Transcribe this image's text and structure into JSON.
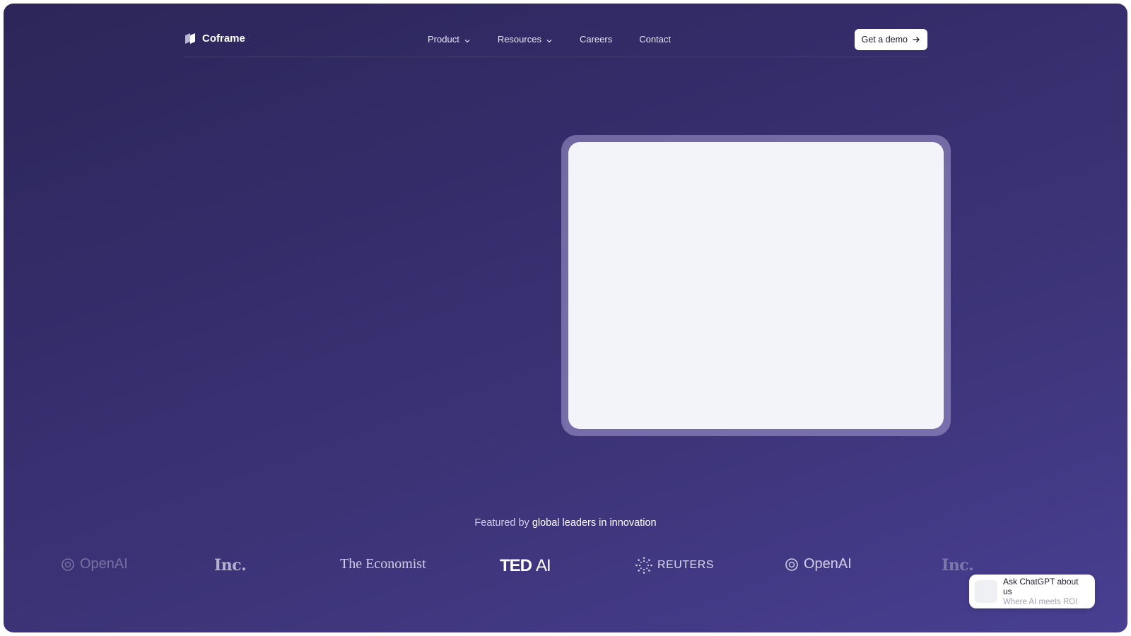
{
  "header": {
    "brand": "Coframe",
    "menu": [
      {
        "label": "Product",
        "has_dropdown": true
      },
      {
        "label": "Resources",
        "has_dropdown": true
      },
      {
        "label": "Careers",
        "has_dropdown": false
      },
      {
        "label": "Contact",
        "has_dropdown": false
      }
    ],
    "cta_label": "Get a demo"
  },
  "featured": {
    "prefix": "Featured by",
    "highlight": "global leaders in innovation"
  },
  "logos": {
    "openai_left": "OpenAI",
    "inc_1": "Inc.",
    "economist": "The Economist",
    "tedai_ted": "TED",
    "tedai_ai": "AI",
    "reuters": "REUTERS",
    "openai_right": "OpenAI",
    "inc_2": "Inc."
  },
  "chat_widget": {
    "title": "Ask ChatGPT about us",
    "subtitle": "Where AI meets ROI"
  },
  "colors": {
    "bg_start": "#2c2659",
    "bg_end": "#483f92",
    "card_surface": "#f3f4f9",
    "cta_bg": "#ffffff"
  }
}
